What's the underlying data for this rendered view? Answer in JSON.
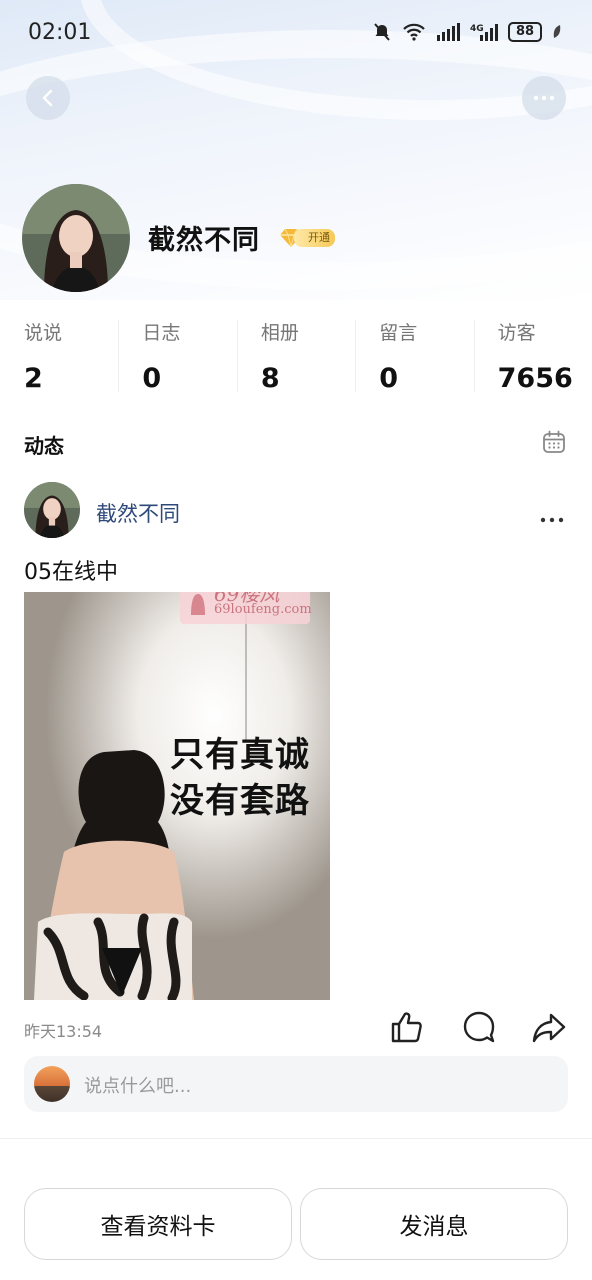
{
  "status_bar": {
    "time": "02:01",
    "battery": "88",
    "signal_label": "4G",
    "wifi_label": "6"
  },
  "header": {
    "back_icon": "chevron-left-icon",
    "more_icon": "more-horizontal-icon"
  },
  "profile": {
    "name": "截然不同",
    "vip_badge": "开通",
    "avatar_icon": "avatar"
  },
  "stats": [
    {
      "label": "说说",
      "value": "2"
    },
    {
      "label": "日志",
      "value": "0"
    },
    {
      "label": "相册",
      "value": "8"
    },
    {
      "label": "留言",
      "value": "0"
    },
    {
      "label": "访客",
      "value": "7656"
    }
  ],
  "feed": {
    "section_title": "动态",
    "calendar_icon": "calendar-icon",
    "post": {
      "author": "截然不同",
      "text": "05在线中",
      "image_caption_line1": "只有真诚",
      "image_caption_line2": "没有套路",
      "watermark_line1": "69楼凤",
      "watermark_line2": "69loufeng.com",
      "time": "昨天13:54"
    }
  },
  "comment": {
    "placeholder": "说点什么吧..."
  },
  "actions": {
    "view_card": "查看资料卡",
    "send_message": "发消息"
  },
  "colors": {
    "author_link": "#2f4a7a",
    "vip_gold": "#f6c956"
  }
}
